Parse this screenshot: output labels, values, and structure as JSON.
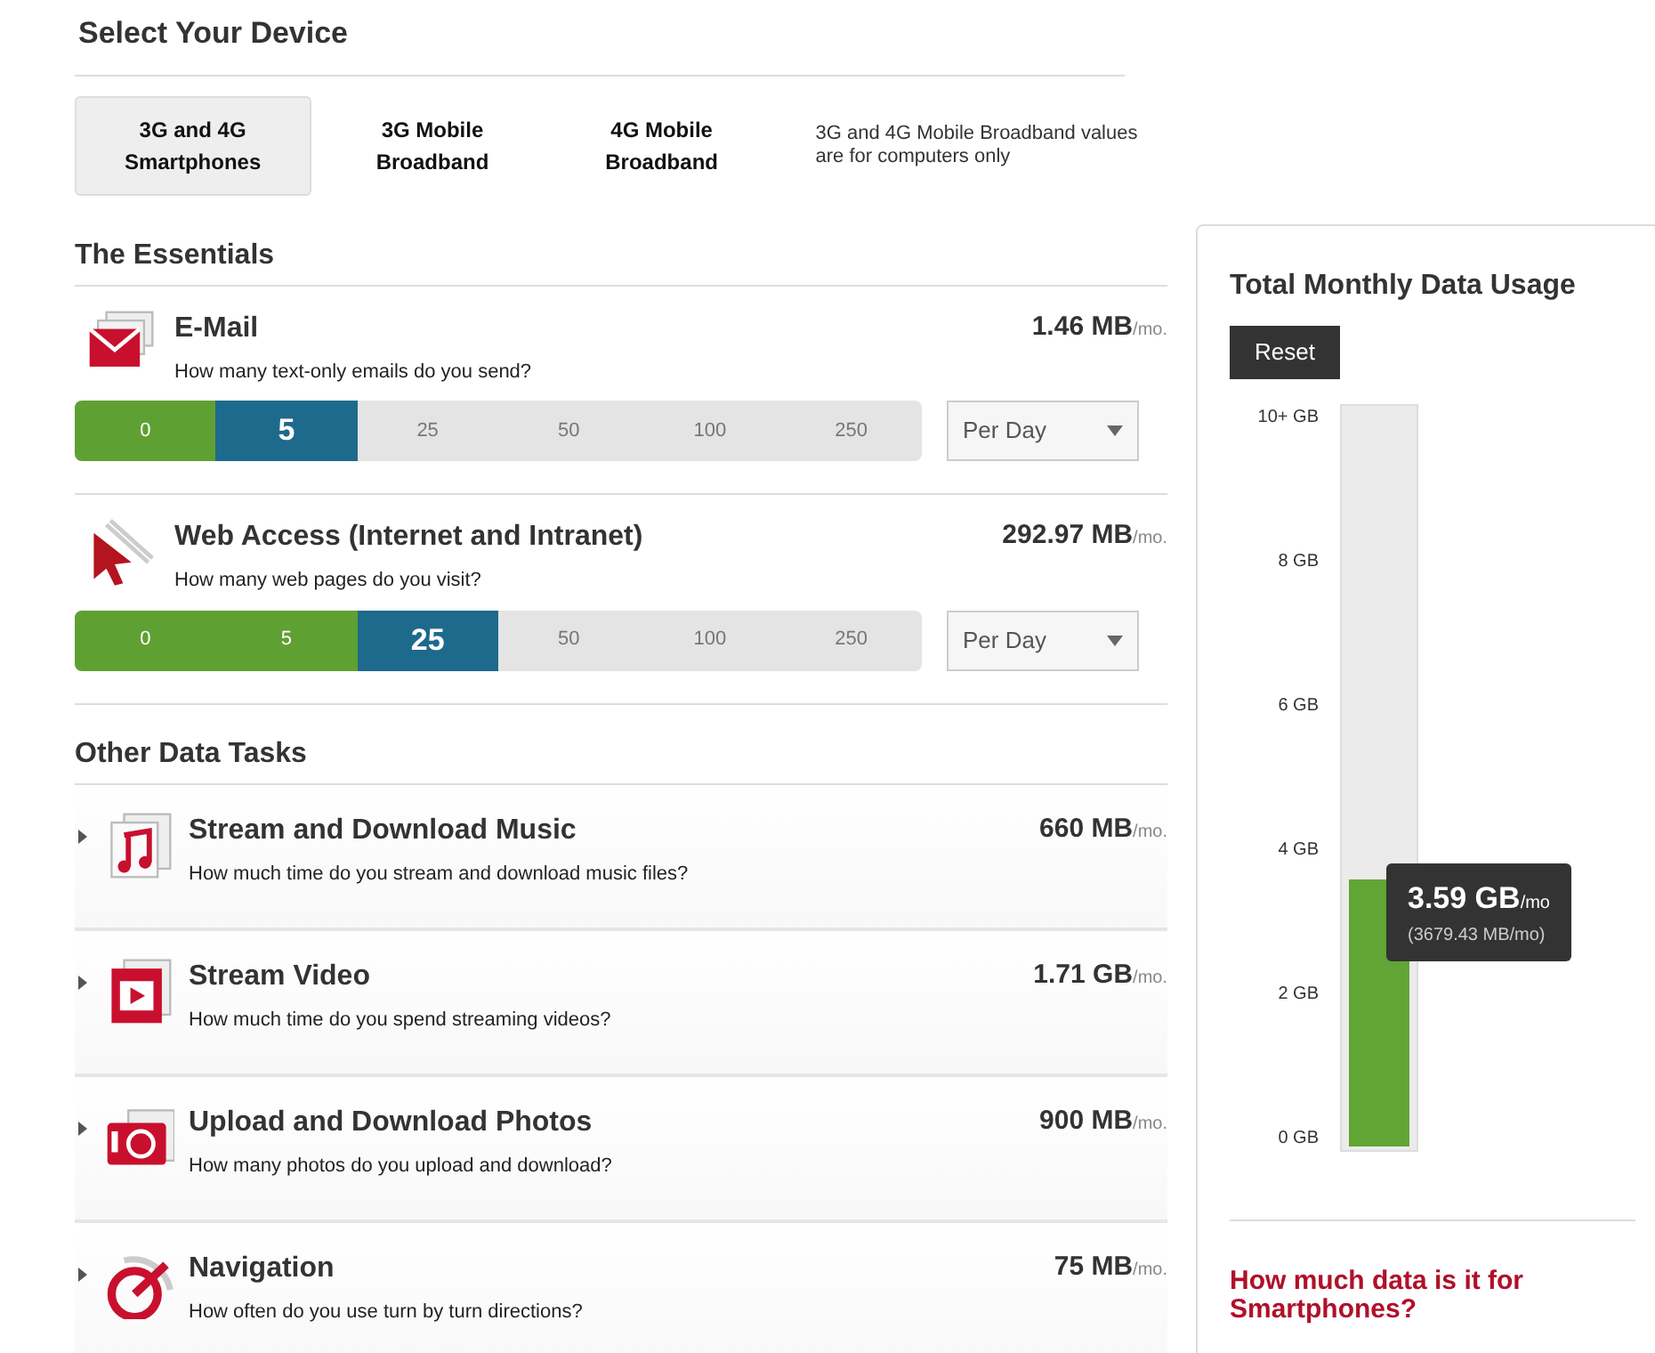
{
  "device_section": {
    "title": "Select Your Device",
    "tabs": [
      {
        "label": "3G and 4G Smartphones",
        "selected": true
      },
      {
        "label": "3G Mobile Broadband",
        "selected": false
      },
      {
        "label": "4G Mobile Broadband",
        "selected": false
      }
    ],
    "note": "3G and 4G Mobile Broadband values are for computers only"
  },
  "essentials": {
    "title": "The Essentials",
    "items": [
      {
        "kind": "mail",
        "title": "E-Mail",
        "question": "How many text-only emails do you send?",
        "amount": "1.46 MB",
        "unit": "/mo.",
        "options": [
          {
            "label": "0",
            "selected": false
          },
          {
            "label": "5",
            "selected": true
          },
          {
            "label": "25",
            "selected": false
          },
          {
            "label": "50",
            "selected": false
          },
          {
            "label": "100",
            "selected": false
          },
          {
            "label": "250",
            "selected": false
          }
        ],
        "period": "Per Day"
      },
      {
        "kind": "cursor",
        "title": "Web Access (Internet and Intranet)",
        "question": "How many web pages do you visit?",
        "amount": "292.97 MB",
        "unit": "/mo.",
        "options": [
          {
            "label": "0",
            "selected": false
          },
          {
            "label": "5",
            "selected": false
          },
          {
            "label": "25",
            "selected": true
          },
          {
            "label": "50",
            "selected": false
          },
          {
            "label": "100",
            "selected": false
          },
          {
            "label": "250",
            "selected": false
          }
        ],
        "period": "Per Day"
      }
    ]
  },
  "other_tasks": {
    "title": "Other Data Tasks",
    "items": [
      {
        "kind": "music",
        "title": "Stream and Download Music",
        "question": "How much time do you stream and download music files?",
        "amount": "660 MB",
        "unit": "/mo.",
        "expanded": false
      },
      {
        "kind": "video",
        "title": "Stream Video",
        "question": "How much time do you spend streaming videos?",
        "amount": "1.71 GB",
        "unit": "/mo.",
        "expanded": false
      },
      {
        "kind": "camera",
        "title": "Upload and Download Photos",
        "question": "How many photos do you upload and download?",
        "amount": "900 MB",
        "unit": "/mo.",
        "expanded": false
      },
      {
        "kind": "gauge",
        "title": "Navigation",
        "question": "How often do you use turn by turn directions?",
        "amount": "75 MB",
        "unit": "/mo.",
        "expanded": false
      }
    ]
  },
  "usage_panel": {
    "title": "Total Monthly Data Usage",
    "reset_label": "Reset",
    "meter": {
      "scale_labels": [
        "10+ GB",
        "8 GB",
        "6 GB",
        "4 GB",
        "2 GB",
        "0 GB"
      ],
      "level": 0.359,
      "value": "3.59 GB",
      "unit": "/mo",
      "detail": "(3679.43 MB/mo)"
    },
    "link": "How much data is it for Smartphones?"
  }
}
